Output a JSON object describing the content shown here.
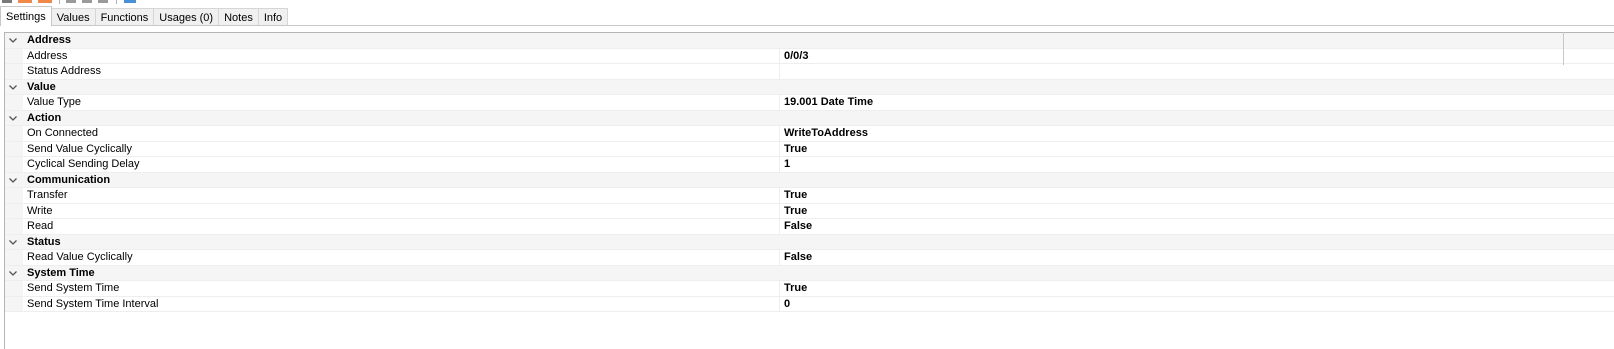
{
  "tabs": [
    {
      "label": "Settings",
      "active": true
    },
    {
      "label": "Values",
      "active": false
    },
    {
      "label": "Functions",
      "active": false
    },
    {
      "label": "Usages (0)",
      "active": false
    },
    {
      "label": "Notes",
      "active": false
    },
    {
      "label": "Info",
      "active": false
    }
  ],
  "colors": {
    "toolbar_accent": "#f0894a",
    "toolbar_blue": "#4a90d9",
    "chevron": "#555555"
  },
  "categories": [
    {
      "name": "Address",
      "properties": [
        {
          "name": "Address",
          "value": "0/0/3"
        },
        {
          "name": "Status Address",
          "value": ""
        }
      ]
    },
    {
      "name": "Value",
      "properties": [
        {
          "name": "Value Type",
          "value": "19.001 Date Time"
        }
      ]
    },
    {
      "name": "Action",
      "properties": [
        {
          "name": "On Connected",
          "value": "WriteToAddress"
        },
        {
          "name": "Send Value Cyclically",
          "value": "True"
        },
        {
          "name": "Cyclical Sending Delay",
          "value": "1"
        }
      ]
    },
    {
      "name": "Communication",
      "properties": [
        {
          "name": "Transfer",
          "value": "True"
        },
        {
          "name": "Write",
          "value": "True"
        },
        {
          "name": "Read",
          "value": "False"
        }
      ]
    },
    {
      "name": "Status",
      "properties": [
        {
          "name": "Read Value Cyclically",
          "value": "False"
        }
      ]
    },
    {
      "name": "System Time",
      "properties": [
        {
          "name": "Send System Time",
          "value": "True"
        },
        {
          "name": "Send System Time Interval",
          "value": "0"
        }
      ]
    }
  ]
}
